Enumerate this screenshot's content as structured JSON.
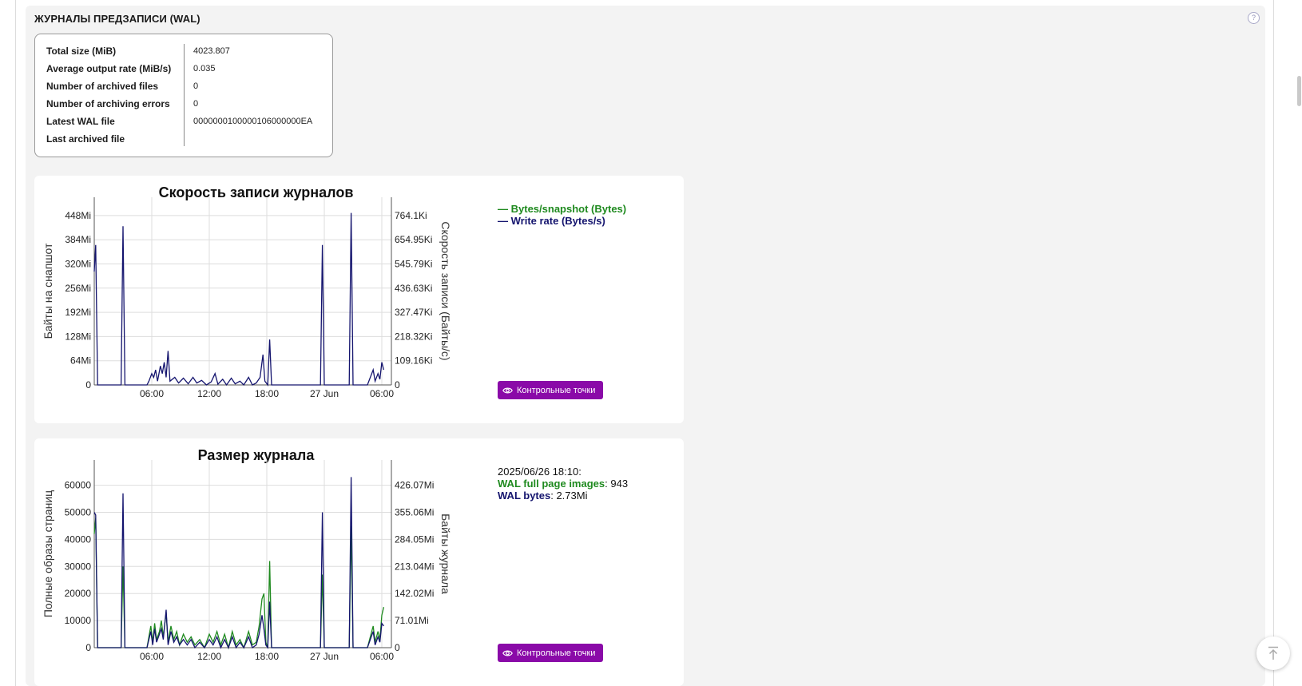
{
  "section": {
    "title": "ЖУРНАЛЫ ПРЕДЗАПИСИ (WAL)",
    "help_icon": "question-circle-icon"
  },
  "wal_info": [
    {
      "label": "Total size (MiB)",
      "value": "4023.807"
    },
    {
      "label": "Average output rate (MiB/s)",
      "value": "0.035"
    },
    {
      "label": "Number of archived files",
      "value": "0"
    },
    {
      "label": "Number of archiving errors",
      "value": "0"
    },
    {
      "label": "Latest WAL file",
      "value": "0000000100000106000000EA"
    },
    {
      "label": "Last archived file",
      "value": ""
    }
  ],
  "colors": {
    "green": "#1f8a1f",
    "navy": "#14146e",
    "button": "#8a0aa8"
  },
  "checkpoints_button": {
    "label": "Контрольные точки",
    "icon": "eye-icon"
  },
  "chart_data": [
    {
      "type": "line",
      "title": "Скорость записи журналов",
      "ylabel": "Байты на снапшот",
      "y2label": "Скорость записи (Байты/с)",
      "x_ticks": [
        "06:00",
        "12:00",
        "18:00",
        "27 Jun",
        "06:00"
      ],
      "y_ticks": [
        "0",
        "64Mi",
        "128Mi",
        "192Mi",
        "256Mi",
        "320Mi",
        "384Mi",
        "448Mi"
      ],
      "y2_ticks": [
        "0",
        "109.16Ki",
        "218.32Ki",
        "327.47Ki",
        "436.63Ki",
        "545.79Ki",
        "654.95Ki",
        "764.1Ki"
      ],
      "ylim_mib": [
        0,
        490
      ],
      "legend_position": "right",
      "series": [
        {
          "name": "Bytes/snapshot (Bytes)",
          "color": "#1f8a1f",
          "values": []
        },
        {
          "name": "Write rate (Bytes/s)",
          "color": "#14146e",
          "points_hours": [
            [
              0,
              300
            ],
            [
              0.15,
              370
            ],
            [
              0.35,
              0
            ],
            [
              2.8,
              0
            ],
            [
              3.0,
              420
            ],
            [
              3.2,
              0
            ],
            [
              5.5,
              0
            ],
            [
              5.7,
              10
            ],
            [
              6.0,
              30
            ],
            [
              6.2,
              20
            ],
            [
              6.4,
              40
            ],
            [
              6.6,
              10
            ],
            [
              6.9,
              50
            ],
            [
              7.1,
              30
            ],
            [
              7.3,
              60
            ],
            [
              7.5,
              20
            ],
            [
              7.7,
              90
            ],
            [
              7.9,
              10
            ],
            [
              8.4,
              20
            ],
            [
              8.8,
              5
            ],
            [
              9.3,
              18
            ],
            [
              9.8,
              3
            ],
            [
              10.3,
              20
            ],
            [
              10.7,
              5
            ],
            [
              11.2,
              12
            ],
            [
              11.7,
              0
            ],
            [
              12.2,
              8
            ],
            [
              12.6,
              30
            ],
            [
              12.9,
              2
            ],
            [
              13.4,
              15
            ],
            [
              13.8,
              0
            ],
            [
              14.3,
              18
            ],
            [
              14.7,
              3
            ],
            [
              15.2,
              10
            ],
            [
              15.6,
              0
            ],
            [
              16.1,
              20
            ],
            [
              16.5,
              0
            ],
            [
              16.9,
              5
            ],
            [
              17.3,
              20
            ],
            [
              17.6,
              80
            ],
            [
              17.8,
              10
            ],
            [
              18.1,
              0
            ],
            [
              18.3,
              120
            ],
            [
              18.5,
              0
            ],
            [
              23.6,
              0
            ],
            [
              23.8,
              370
            ],
            [
              24.0,
              0
            ],
            [
              26.6,
              0
            ],
            [
              26.8,
              455
            ],
            [
              27.0,
              0
            ],
            [
              28.5,
              0
            ],
            [
              28.8,
              20
            ],
            [
              29.1,
              40
            ],
            [
              29.3,
              10
            ],
            [
              29.6,
              30
            ],
            [
              29.8,
              15
            ],
            [
              30.0,
              60
            ],
            [
              30.2,
              40
            ]
          ]
        }
      ]
    },
    {
      "type": "line",
      "title": "Размер журнала",
      "ylabel": "Полные образы страниц",
      "y2label": "Байты журнала",
      "x_ticks": [
        "06:00",
        "12:00",
        "18:00",
        "27 Jun",
        "06:00"
      ],
      "y_ticks": [
        "0",
        "10000",
        "20000",
        "30000",
        "40000",
        "50000",
        "60000"
      ],
      "y2_ticks": [
        "0",
        "71.01Mi",
        "142.02Mi",
        "213.04Mi",
        "284.05Mi",
        "355.06Mi",
        "426.07Mi"
      ],
      "ylim": [
        0,
        69000
      ],
      "tooltip": {
        "time": "2025/06/26 18:10:",
        "key1": "WAL full page images",
        "val1": "943",
        "key2": "WAL bytes",
        "val2": "2.73Mi"
      },
      "series": [
        {
          "name": "WAL full page images",
          "color": "#1f8a1f",
          "points_hours": [
            [
              0,
              42000
            ],
            [
              0.15,
              48000
            ],
            [
              0.35,
              0
            ],
            [
              2.8,
              0
            ],
            [
              3.0,
              30000
            ],
            [
              3.2,
              0
            ],
            [
              5.5,
              0
            ],
            [
              5.7,
              4000
            ],
            [
              5.9,
              8000
            ],
            [
              6.1,
              2000
            ],
            [
              6.3,
              9000
            ],
            [
              6.5,
              3000
            ],
            [
              6.8,
              6000
            ],
            [
              7.0,
              10000
            ],
            [
              7.2,
              4000
            ],
            [
              7.5,
              13000
            ],
            [
              7.7,
              2000
            ],
            [
              8.0,
              8000
            ],
            [
              8.3,
              3000
            ],
            [
              8.6,
              6000
            ],
            [
              8.9,
              1000
            ],
            [
              9.3,
              5000
            ],
            [
              9.7,
              2000
            ],
            [
              10.1,
              4000
            ],
            [
              10.5,
              1000
            ],
            [
              11.0,
              3000
            ],
            [
              11.5,
              0
            ],
            [
              12.0,
              5000
            ],
            [
              12.4,
              2000
            ],
            [
              12.8,
              6000
            ],
            [
              13.2,
              1000
            ],
            [
              13.6,
              5000
            ],
            [
              14.0,
              0
            ],
            [
              14.4,
              6000
            ],
            [
              14.8,
              1000
            ],
            [
              15.2,
              3000
            ],
            [
              15.6,
              0
            ],
            [
              16.1,
              6000
            ],
            [
              16.5,
              1000
            ],
            [
              16.9,
              2000
            ],
            [
              17.2,
              8000
            ],
            [
              17.5,
              18000
            ],
            [
              17.7,
              20000
            ],
            [
              17.9,
              2000
            ],
            [
              18.1,
              0
            ],
            [
              18.3,
              32000
            ],
            [
              18.5,
              0
            ],
            [
              23.6,
              0
            ],
            [
              23.8,
              27000
            ],
            [
              24.0,
              0
            ],
            [
              26.6,
              0
            ],
            [
              26.8,
              45000
            ],
            [
              27.0,
              0
            ],
            [
              28.5,
              0
            ],
            [
              28.8,
              4000
            ],
            [
              29.1,
              8000
            ],
            [
              29.3,
              2000
            ],
            [
              29.6,
              6000
            ],
            [
              29.8,
              3000
            ],
            [
              30.0,
              12000
            ],
            [
              30.2,
              15000
            ]
          ]
        },
        {
          "name": "WAL bytes",
          "color": "#14146e",
          "points_hours": [
            [
              0,
              50000
            ],
            [
              0.15,
              49000
            ],
            [
              0.35,
              0
            ],
            [
              2.8,
              0
            ],
            [
              3.0,
              57000
            ],
            [
              3.2,
              0
            ],
            [
              5.5,
              0
            ],
            [
              5.7,
              3000
            ],
            [
              5.9,
              6000
            ],
            [
              6.1,
              1000
            ],
            [
              6.3,
              7000
            ],
            [
              6.5,
              2000
            ],
            [
              6.8,
              5000
            ],
            [
              7.0,
              7000
            ],
            [
              7.2,
              3000
            ],
            [
              7.5,
              14000
            ],
            [
              7.7,
              1000
            ],
            [
              8.0,
              6000
            ],
            [
              8.3,
              2000
            ],
            [
              8.6,
              4000
            ],
            [
              8.9,
              1000
            ],
            [
              9.3,
              3000
            ],
            [
              9.7,
              1000
            ],
            [
              10.1,
              3000
            ],
            [
              10.5,
              0
            ],
            [
              11.0,
              2000
            ],
            [
              11.5,
              0
            ],
            [
              12.0,
              3000
            ],
            [
              12.4,
              1000
            ],
            [
              12.8,
              4000
            ],
            [
              13.2,
              0
            ],
            [
              13.6,
              3000
            ],
            [
              14.0,
              0
            ],
            [
              14.4,
              4000
            ],
            [
              14.8,
              0
            ],
            [
              15.2,
              2000
            ],
            [
              15.6,
              0
            ],
            [
              16.1,
              4000
            ],
            [
              16.5,
              0
            ],
            [
              16.9,
              1000
            ],
            [
              17.2,
              5000
            ],
            [
              17.5,
              12000
            ],
            [
              17.7,
              7000
            ],
            [
              17.9,
              1000
            ],
            [
              18.1,
              0
            ],
            [
              18.3,
              17000
            ],
            [
              18.5,
              0
            ],
            [
              23.6,
              0
            ],
            [
              23.8,
              50000
            ],
            [
              24.0,
              0
            ],
            [
              26.6,
              0
            ],
            [
              26.8,
              63000
            ],
            [
              27.0,
              0
            ],
            [
              28.5,
              0
            ],
            [
              28.8,
              3000
            ],
            [
              29.1,
              6000
            ],
            [
              29.3,
              1000
            ],
            [
              29.6,
              4000
            ],
            [
              29.8,
              2000
            ],
            [
              30.0,
              9000
            ],
            [
              30.2,
              8000
            ]
          ]
        }
      ]
    }
  ]
}
